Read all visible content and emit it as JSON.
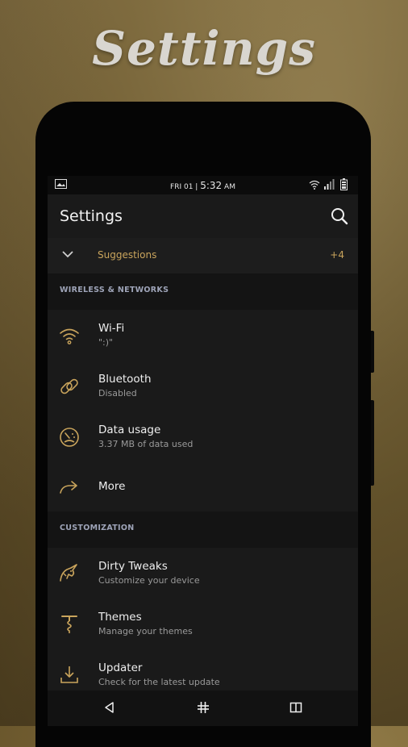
{
  "banner": {
    "title": "Settings"
  },
  "status_bar": {
    "date": "FRI 01 |",
    "time": "5:32",
    "ampm": "AM"
  },
  "app_bar": {
    "title": "Settings"
  },
  "suggestions": {
    "label": "Suggestions",
    "count": "+4"
  },
  "sections": [
    {
      "header": "WIRELESS & NETWORKS",
      "items": [
        {
          "title": "Wi-Fi",
          "subtitle": "\":)\"",
          "icon": "wifi-icon"
        },
        {
          "title": "Bluetooth",
          "subtitle": "Disabled",
          "icon": "bluetooth-link-icon"
        },
        {
          "title": "Data usage",
          "subtitle": "3.37 MB of data used",
          "icon": "data-usage-gauge-icon"
        },
        {
          "title": "More",
          "icon": "forward-arrow-icon"
        }
      ]
    },
    {
      "header": "CUSTOMIZATION",
      "items": [
        {
          "title": "Dirty Tweaks",
          "subtitle": "Customize your device",
          "icon": "unicorn-icon"
        },
        {
          "title": "Themes",
          "subtitle": "Manage your themes",
          "icon": "corkscrew-icon"
        },
        {
          "title": "Updater",
          "subtitle": "Check for the latest update",
          "icon": "download-icon"
        }
      ]
    }
  ],
  "colors": {
    "accent": "#c9a45c",
    "background": "#151515",
    "section_header": "#9ea4b8"
  },
  "nav_bar": {
    "buttons": [
      "back-icon",
      "home-icon",
      "recents-icon"
    ]
  }
}
